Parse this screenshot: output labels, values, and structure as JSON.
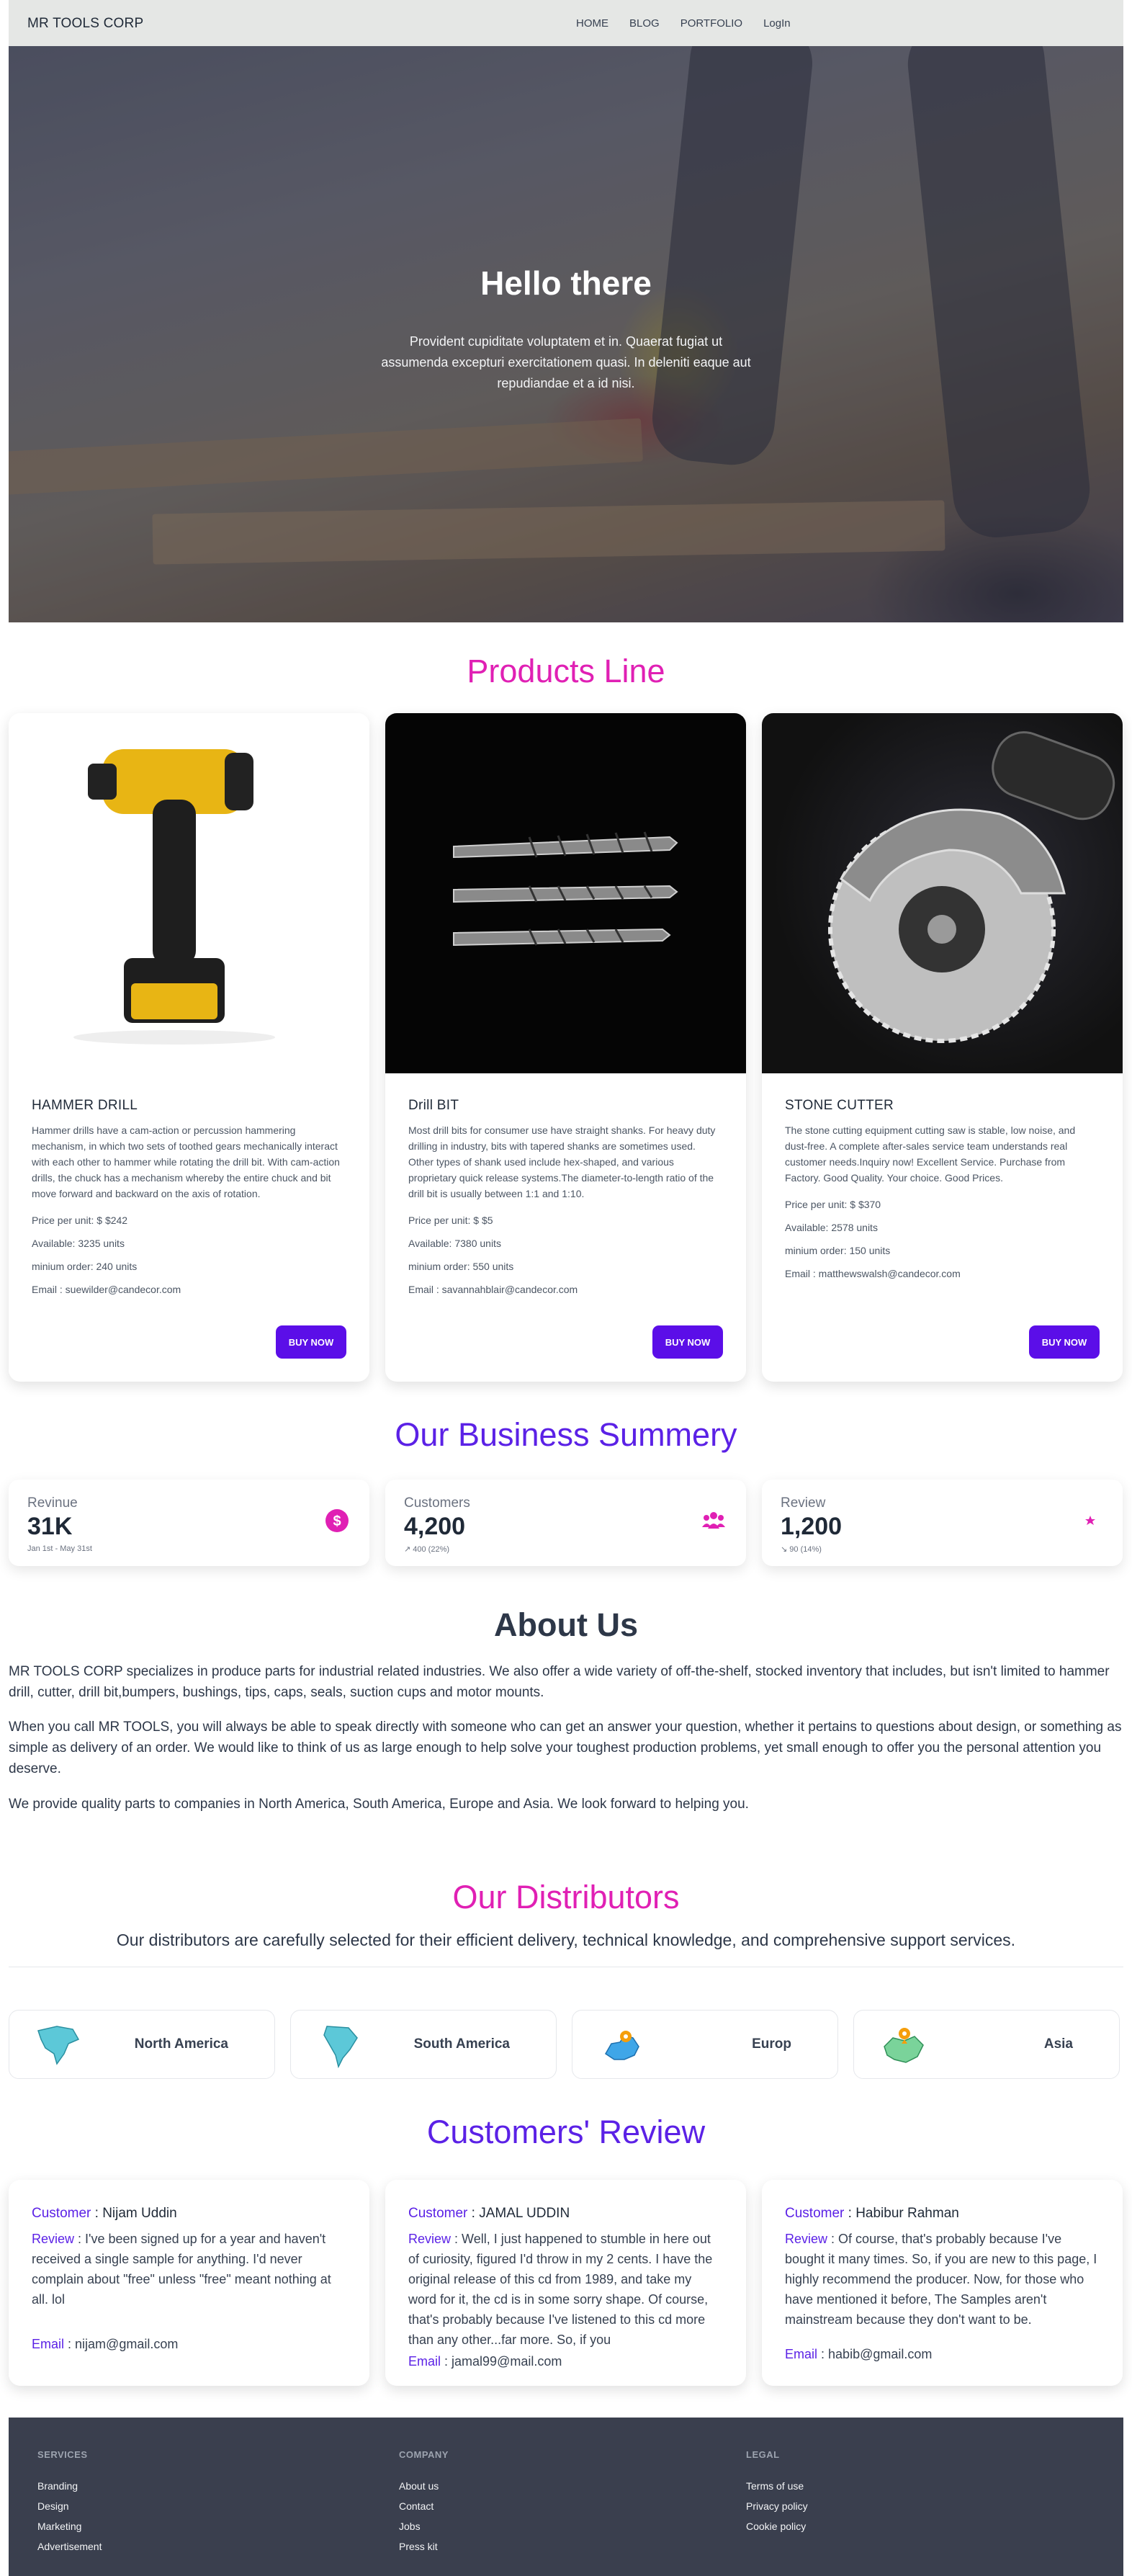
{
  "nav": {
    "brand": "MR TOOLS CORP",
    "items": [
      "HOME",
      "BLOG",
      "PORTFOLIO",
      "LogIn"
    ]
  },
  "hero": {
    "title": "Hello there",
    "text": "Provident cupiditate voluptatem et in. Quaerat fugiat ut assumenda excepturi exercitationem quasi. In deleniti eaque aut repudiandae et a id nisi."
  },
  "products": {
    "title": "Products Line",
    "buy_label": "BUY NOW",
    "items": [
      {
        "name": "HAMMER DRILL",
        "desc": "Hammer drills have a cam-action or percussion hammering mechanism, in which two sets of toothed gears mechanically interact with each other to hammer while rotating the drill bit. With cam-action drills, the chuck has a mechanism whereby the entire chuck and bit move forward and backward on the axis of rotation.",
        "price": "Price per unit: $ $242",
        "available": "Available: 3235 units",
        "min_order": "minium order: 240 units",
        "email": "Email : suewilder@candecor.com"
      },
      {
        "name": "Drill BIT",
        "desc": "Most drill bits for consumer use have straight shanks. For heavy duty drilling in industry, bits with tapered shanks are sometimes used. Other types of shank used include hex-shaped, and various proprietary quick release systems.The diameter-to-length ratio of the drill bit is usually between 1:1 and 1:10.",
        "price": "Price per unit: $ $5",
        "available": "Available: 7380 units",
        "min_order": "minium order: 550 units",
        "email": "Email : savannahblair@candecor.com"
      },
      {
        "name": "STONE CUTTER",
        "desc": "The stone cutting equipment cutting saw is stable, low noise, and dust-free. A complete after-sales service team understands real customer needs.Inquiry now! Excellent Service. Purchase from Factory. Good Quality. Your choice. Good Prices.",
        "price": "Price per unit: $ $370",
        "available": "Available: 2578 units",
        "min_order": "minium order: 150 units",
        "email": "Email : matthewswalsh@candecor.com"
      }
    ]
  },
  "summary": {
    "title": "Our Business Summery",
    "stats": [
      {
        "label": "Revinue",
        "value": "31K",
        "sub": "Jan 1st - May 31st",
        "icon": "dollar-icon"
      },
      {
        "label": "Customers",
        "value": "4,200",
        "sub": "↗ 400 (22%)",
        "icon": "users-icon"
      },
      {
        "label": "Review",
        "value": "1,200",
        "sub": "↘ 90 (14%)",
        "icon": "star-icon"
      }
    ]
  },
  "about": {
    "title": "About Us",
    "paragraphs": [
      "MR TOOLS CORP specializes in produce parts for industrial related industries. We also offer a wide variety of off-the-shelf, stocked inventory that includes, but isn't limited to hammer drill, cutter, drill bit,bumpers, bushings, tips, caps, seals, suction cups and motor mounts.",
      "When you call MR TOOLS, you will always be able to speak directly with someone who can get an answer your question, whether it pertains to questions about design, or something as simple as delivery of an order. We would like to think of us as large enough to help solve your toughest production problems, yet small enough to offer you the personal attention you deserve.",
      "We provide quality parts to companies in North America, South America, Europe and Asia. We look forward to helping you."
    ]
  },
  "distributors": {
    "title": "Our Distributors",
    "subtitle": "Our distributors are carefully selected for their efficient delivery, technical knowledge, and comprehensive support services.",
    "items": [
      {
        "name": "North America",
        "icon": "north-america-map-icon"
      },
      {
        "name": "South America",
        "icon": "south-america-map-icon"
      },
      {
        "name": "Europ",
        "icon": "europe-map-icon"
      },
      {
        "name": "Asia",
        "icon": "asia-map-icon"
      }
    ]
  },
  "reviews": {
    "title": "Customers' Review",
    "customer_label": "Customer",
    "review_label": "Review",
    "email_label": "Email",
    "items": [
      {
        "name": ": Nijam Uddin",
        "text": ": I've been signed up for a year and haven't received a single sample for anything. I'd never complain about \"free\" unless \"free\" meant nothing at all. lol",
        "email": ": nijam@gmail.com"
      },
      {
        "name": ": JAMAL UDDIN",
        "text": ": Well, I just happened to stumble in here out of curiosity, figured I'd throw in my 2 cents. I have the original release of this cd from 1989, and take my word for it, the cd is in some sorry shape. Of course, that's probably because I've listened to this cd more than any other...far more. So, if you",
        "email": ": jamal99@mail.com"
      },
      {
        "name": ": Habibur Rahman",
        "text": ": Of course, that's probably because I've bought it many times. So, if you are new to this page, I highly recommend the producer. Now, for those who have mentioned it before, The Samples aren't mainstream because they don't want to be.",
        "email": ": habib@gmail.com"
      }
    ]
  },
  "footer": {
    "services": {
      "title": "SERVICES",
      "links": [
        "Branding",
        "Design",
        "Marketing",
        "Advertisement"
      ]
    },
    "company": {
      "title": "COMPANY",
      "links": [
        "About us",
        "Contact",
        "Jobs",
        "Press kit"
      ]
    },
    "legal": {
      "title": "LEGAL",
      "links": [
        "Terms of use",
        "Privacy policy",
        "Cookie policy"
      ]
    }
  },
  "colors": {
    "pink": "#e020b4",
    "violet": "#5b21e6",
    "button": "#5b0ee8",
    "footer_bg": "#3a3f4e"
  }
}
